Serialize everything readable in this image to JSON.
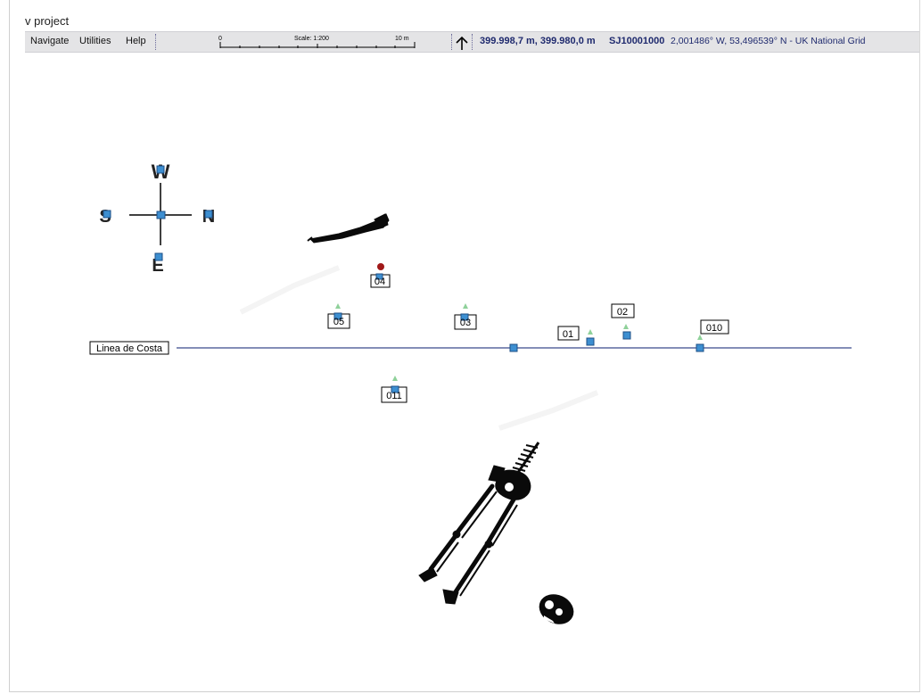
{
  "window": {
    "title": "v project"
  },
  "menu": {
    "items": [
      {
        "label": "Navigate"
      },
      {
        "label": "Utilities"
      },
      {
        "label": "Help"
      }
    ]
  },
  "scale_bar": {
    "start_label": "0",
    "scale_label": "Scale: 1:200",
    "end_label": "10 m"
  },
  "status": {
    "coords_m": "399.998,7 m, 399.980,0 m",
    "grid_ref": "SJ10001000",
    "latlon": "2,001486° W,  53,496539° N  -  UK National Grid"
  },
  "compass": {
    "top": "W",
    "left": "S",
    "right": "N",
    "bottom": "E"
  },
  "map": {
    "coastline_label": "Linea de Costa",
    "markers": [
      {
        "label": "04"
      },
      {
        "label": "05"
      },
      {
        "label": "03"
      },
      {
        "label": "01"
      },
      {
        "label": "02"
      },
      {
        "label": "010"
      },
      {
        "label": "011"
      }
    ]
  },
  "colors": {
    "toolbar_bg": "#e4e4e6",
    "status_text": "#1f2a6e",
    "marker_fill": "#3d8fd1",
    "marker_stroke": "#1d4f86",
    "triangle": "#8fd19a",
    "red_point": "#a01818",
    "coast_line": "#3a4a8c"
  }
}
